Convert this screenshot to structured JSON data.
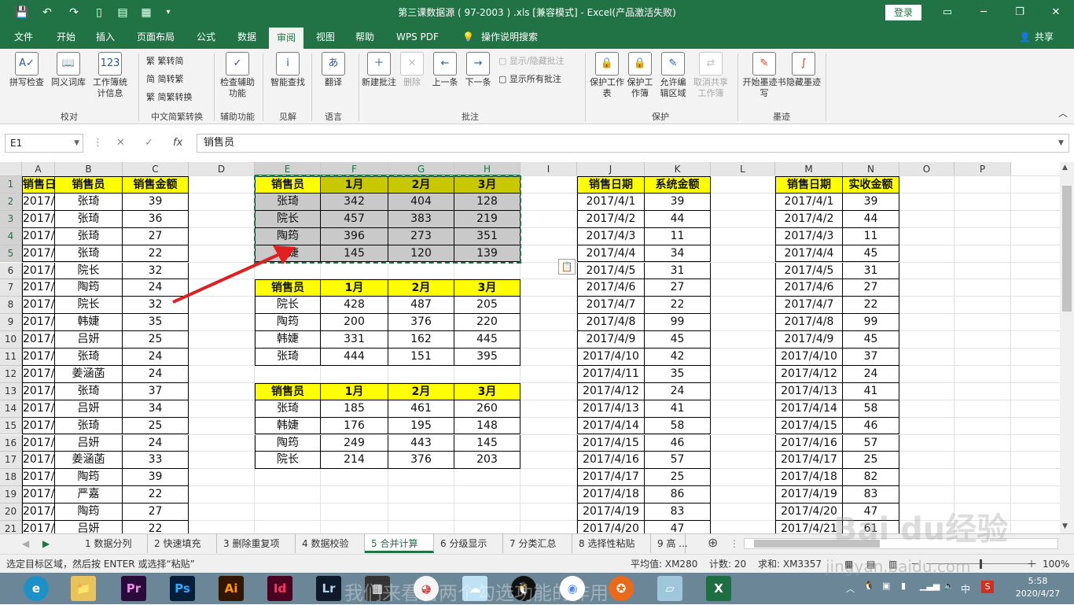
{
  "window": {
    "title": "第三课数据源 ( 97-2003 ) .xls  [兼容模式]  -  Excel(产品激活失败)",
    "login": "登录"
  },
  "quick_access": {
    "save_icon": "save-icon",
    "undo_icon": "undo-icon",
    "redo_icon": "redo-icon"
  },
  "menu": {
    "tabs": [
      "文件",
      "开始",
      "插入",
      "页面布局",
      "公式",
      "数据",
      "审阅",
      "视图",
      "帮助",
      "WPS PDF",
      "操作说明搜索"
    ],
    "share": "共享"
  },
  "ribbon": {
    "buttons": [
      "拼写检查",
      "同义词库",
      "工作簿统计信息",
      "检查辅助功能",
      "智能查找",
      "翻译",
      "新建批注",
      "删除",
      "上一条",
      "下一条",
      "保护工作表",
      "保护工作簿",
      "允许编辑区域",
      "取消共享工作簿",
      "开始墨迹书写",
      "隐藏墨迹"
    ],
    "small": [
      "繁转简",
      "简转繁",
      "简繁转换",
      "显示/隐藏批注",
      "显示所有批注"
    ],
    "groups": [
      "校对",
      "中文简繁转换",
      "辅助功能",
      "见解",
      "语言",
      "批注",
      "保护",
      "墨迹"
    ]
  },
  "formula_bar": {
    "name_box": "E1",
    "fx": "fx",
    "value": "销售员"
  },
  "columns": [
    "A",
    "B",
    "C",
    "D",
    "E",
    "F",
    "G",
    "H",
    "I",
    "J",
    "K",
    "L",
    "M",
    "N",
    "O",
    "P"
  ],
  "rows": [
    "1",
    "2",
    "3",
    "4",
    "5",
    "6",
    "7",
    "8",
    "9",
    "10",
    "11",
    "12",
    "13",
    "14",
    "15",
    "16",
    "17",
    "18",
    "19",
    "20",
    "21"
  ],
  "table_abc": {
    "headers": [
      "销售日期",
      "销售员",
      "销售金额"
    ],
    "rows": [
      [
        "2017/4/1",
        "张琦",
        "39"
      ],
      [
        "2017/4/1",
        "张琦",
        "36"
      ],
      [
        "2017/4/1",
        "张琦",
        "27"
      ],
      [
        "2017/4/1",
        "张琦",
        "22"
      ],
      [
        "2017/4/1",
        "院长",
        "32"
      ],
      [
        "2017/4/5",
        "陶筠",
        "24"
      ],
      [
        "2017/4/5",
        "院长",
        "32"
      ],
      [
        "2017/4/5",
        "韩婕",
        "35"
      ],
      [
        "2017/4/5",
        "吕妍",
        "25"
      ],
      [
        "2017/4/5",
        "张琦",
        "24"
      ],
      [
        "2017/4/5",
        "姜涵菡",
        "24"
      ],
      [
        "2017/4/8",
        "张琦",
        "37"
      ],
      [
        "2017/4/8",
        "吕妍",
        "34"
      ],
      [
        "2017/4/8",
        "张琦",
        "25"
      ],
      [
        "2017/4/8",
        "吕妍",
        "24"
      ],
      [
        "2017/4/8",
        "姜涵菡",
        "33"
      ],
      [
        "2017/4/8",
        "陶筠",
        "39"
      ],
      [
        "2017/4/10",
        "严嘉",
        "22"
      ],
      [
        "2017/4/10",
        "陶筠",
        "27"
      ],
      [
        "2017/4/10",
        "吕妍",
        "22"
      ]
    ]
  },
  "table_result": {
    "headers": [
      "销售员",
      "1月",
      "2月",
      "3月"
    ],
    "rows": [
      [
        "张琦",
        "342",
        "404",
        "128"
      ],
      [
        "院长",
        "457",
        "383",
        "219"
      ],
      [
        "陶筠",
        "396",
        "273",
        "351"
      ],
      [
        "韩婕",
        "145",
        "120",
        "139"
      ]
    ]
  },
  "table_2": {
    "headers": [
      "销售员",
      "1月",
      "2月",
      "3月"
    ],
    "rows": [
      [
        "院长",
        "428",
        "487",
        "205"
      ],
      [
        "陶筠",
        "200",
        "376",
        "220"
      ],
      [
        "韩婕",
        "331",
        "162",
        "445"
      ],
      [
        "张琦",
        "444",
        "151",
        "395"
      ]
    ]
  },
  "table_3": {
    "headers": [
      "销售员",
      "1月",
      "2月",
      "3月"
    ],
    "rows": [
      [
        "张琦",
        "185",
        "461",
        "260"
      ],
      [
        "韩婕",
        "176",
        "195",
        "148"
      ],
      [
        "陶筠",
        "249",
        "443",
        "145"
      ],
      [
        "院长",
        "214",
        "376",
        "203"
      ]
    ]
  },
  "table_jk": {
    "headers": [
      "销售日期",
      "系统金额"
    ],
    "rows": [
      [
        "2017/4/1",
        "39"
      ],
      [
        "2017/4/2",
        "44"
      ],
      [
        "2017/4/3",
        "11"
      ],
      [
        "2017/4/4",
        "34"
      ],
      [
        "2017/4/5",
        "31"
      ],
      [
        "2017/4/6",
        "27"
      ],
      [
        "2017/4/7",
        "22"
      ],
      [
        "2017/4/8",
        "99"
      ],
      [
        "2017/4/9",
        "45"
      ],
      [
        "2017/4/10",
        "42"
      ],
      [
        "2017/4/11",
        "35"
      ],
      [
        "2017/4/12",
        "24"
      ],
      [
        "2017/4/13",
        "41"
      ],
      [
        "2017/4/14",
        "58"
      ],
      [
        "2017/4/15",
        "46"
      ],
      [
        "2017/4/16",
        "57"
      ],
      [
        "2017/4/17",
        "25"
      ],
      [
        "2017/4/18",
        "86"
      ],
      [
        "2017/4/19",
        "83"
      ],
      [
        "2017/4/20",
        "47"
      ]
    ]
  },
  "table_mn": {
    "headers": [
      "销售日期",
      "实收金额"
    ],
    "rows": [
      [
        "2017/4/1",
        "39"
      ],
      [
        "2017/4/2",
        "44"
      ],
      [
        "2017/4/3",
        "11"
      ],
      [
        "2017/4/4",
        "45"
      ],
      [
        "2017/4/5",
        "31"
      ],
      [
        "2017/4/6",
        "27"
      ],
      [
        "2017/4/7",
        "22"
      ],
      [
        "2017/4/8",
        "99"
      ],
      [
        "2017/4/9",
        "45"
      ],
      [
        "2017/4/10",
        "37"
      ],
      [
        "2017/4/12",
        "24"
      ],
      [
        "2017/4/13",
        "41"
      ],
      [
        "2017/4/14",
        "58"
      ],
      [
        "2017/4/15",
        "46"
      ],
      [
        "2017/4/16",
        "57"
      ],
      [
        "2017/4/17",
        "25"
      ],
      [
        "2017/4/18",
        "82"
      ],
      [
        "2017/4/19",
        "83"
      ],
      [
        "2017/4/20",
        "47"
      ],
      [
        "2017/4/21",
        "61"
      ]
    ]
  },
  "sheet_tabs": [
    "1 数据分列",
    "2 快速填充",
    "3 删除重复项",
    "4 数据校验",
    "5 合并计算",
    "6 分级显示",
    "7 分类汇总",
    "8 选择性粘贴",
    "9 高 ..."
  ],
  "active_sheet": "5 合并计算",
  "status": {
    "message": "选定目标区域，然后按 ENTER 或选择“粘贴”",
    "average": "平均值: XM280",
    "count": "计数: 20",
    "sum": "求和: XM3357",
    "zoom": "100%"
  },
  "taskbar": {
    "apps": [
      "Pr",
      "Ps",
      "Ai",
      "Id",
      "Lr"
    ],
    "time": "5:58",
    "date": "2020/4/27",
    "ime": "中"
  },
  "watermark": {
    "caption": "我们来看看两个勾选功能的作用",
    "site": "jingyan.baidu.com"
  },
  "colors": {
    "excel_green": "#217346",
    "header_yellow": "#ffff00",
    "selection_gray": "#c9c9c9",
    "arrow_red": "#e02020"
  }
}
